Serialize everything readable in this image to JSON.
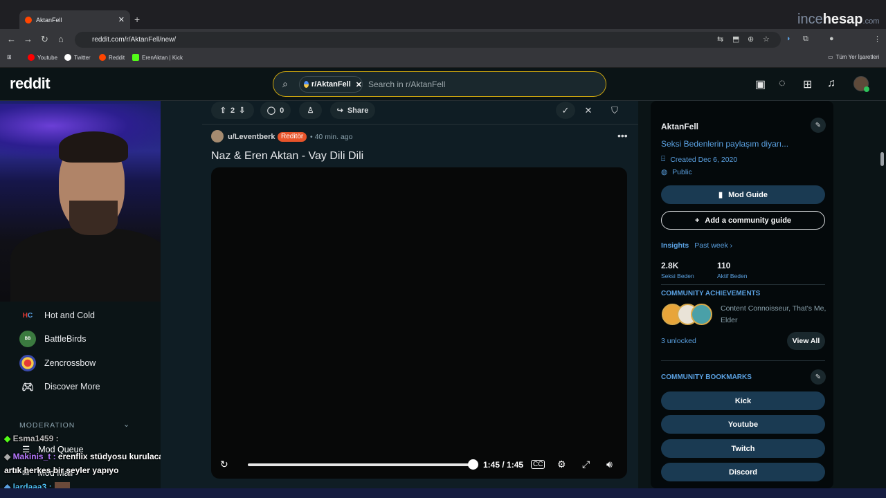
{
  "browser": {
    "tab_title": "AktanFell",
    "url": "reddit.com/r/AktanFell/new/",
    "watermark_a": "ince",
    "watermark_b": "hesap",
    "watermark_c": ".com",
    "bookmarks": [
      {
        "label": "Youtube",
        "color": "#ff0000"
      },
      {
        "label": "Twitter",
        "color": "#ffffff"
      },
      {
        "label": "Reddit",
        "color": "#ff4500"
      },
      {
        "label": "ErenAktan | Kick",
        "color": "#53fc18"
      }
    ],
    "all_bookmarks": "Tüm Yer İşaretleri"
  },
  "header": {
    "logo": "reddit",
    "chip_label": "r/AktanFell",
    "search_placeholder": "Search in r/AktanFell"
  },
  "leftnav": {
    "items": [
      {
        "label": "Hot and Cold",
        "icon": "hot-and-cold-icon"
      },
      {
        "label": "BattleBirds",
        "icon": "battlebirds-icon"
      },
      {
        "label": "Zencrossbow",
        "icon": "zencrossbow-icon"
      },
      {
        "label": "Discover More",
        "icon": "gamepad-icon"
      }
    ],
    "moderation_label": "MODERATION",
    "mod_items": [
      "Mod Queue",
      "Mod Mail"
    ]
  },
  "chat": {
    "line1_user": "Esma1459 :",
    "line2_user": "Makinis_t :",
    "line2_msg": "erenflix stüdyosu kurulacak",
    "line3": "artık herkes bir şeyler yapıyo",
    "line4_user": "lardaaa3 :"
  },
  "prev_post": {
    "votes": "2",
    "comments": "0",
    "share": "Share"
  },
  "post": {
    "user": "u/Leventberk",
    "flair": "Reditör",
    "time": "• 40 min. ago",
    "title": "Naz & Eren Aktan - Vay Dili Dili",
    "video_time": "1:45 / 1:45",
    "video_progress": 1.0
  },
  "sidebar": {
    "name": "AktanFell",
    "description": "Seksi Bedenlerin paylaşım diyarı...",
    "created": "Created Dec 6, 2020",
    "visibility": "Public",
    "mod_guide": "Mod Guide",
    "add_guide": "Add a community guide",
    "insights": "Insights",
    "past_week": "Past week ›",
    "stat1_value": "2.8K",
    "stat1_label": "Seksi Beden",
    "stat2_value": "110",
    "stat2_label": "Aktif Beden",
    "achievements_head": "COMMUNITY ACHIEVEMENTS",
    "achievements_text": "Content Connoisseur, That's Me, Elder",
    "unlocked": "3 unlocked",
    "view_all": "View All",
    "bookmarks_head": "COMMUNITY BOOKMARKS",
    "bookmarks": [
      "Kick",
      "Youtube",
      "Twitch",
      "Discord"
    ]
  }
}
